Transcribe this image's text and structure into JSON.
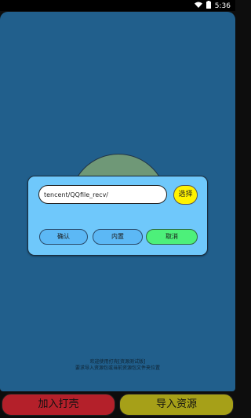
{
  "status_bar": {
    "time": "5:36",
    "wifi_icon": "wifi-icon",
    "battery_icon": "battery-icon"
  },
  "dialog": {
    "path_value": "tencent/QQfile_recv/",
    "choose_label": "选择",
    "confirm_label": "确认",
    "builtin_label": "内置",
    "cancel_label": "取消"
  },
  "hint": {
    "line1": "欢迎使用打壳[资源测试版]",
    "line2": "要求导入资源包或当前资源包文件夹位置"
  },
  "bottom": {
    "add_shell_label": "加入打壳",
    "import_label": "导入资源"
  },
  "colors": {
    "panel": "#215f8c",
    "dialog": "#6fc8fb",
    "choose": "#fff200",
    "cancel": "#4df07a",
    "add_shell": "#b4202a",
    "import": "#a6a018"
  }
}
